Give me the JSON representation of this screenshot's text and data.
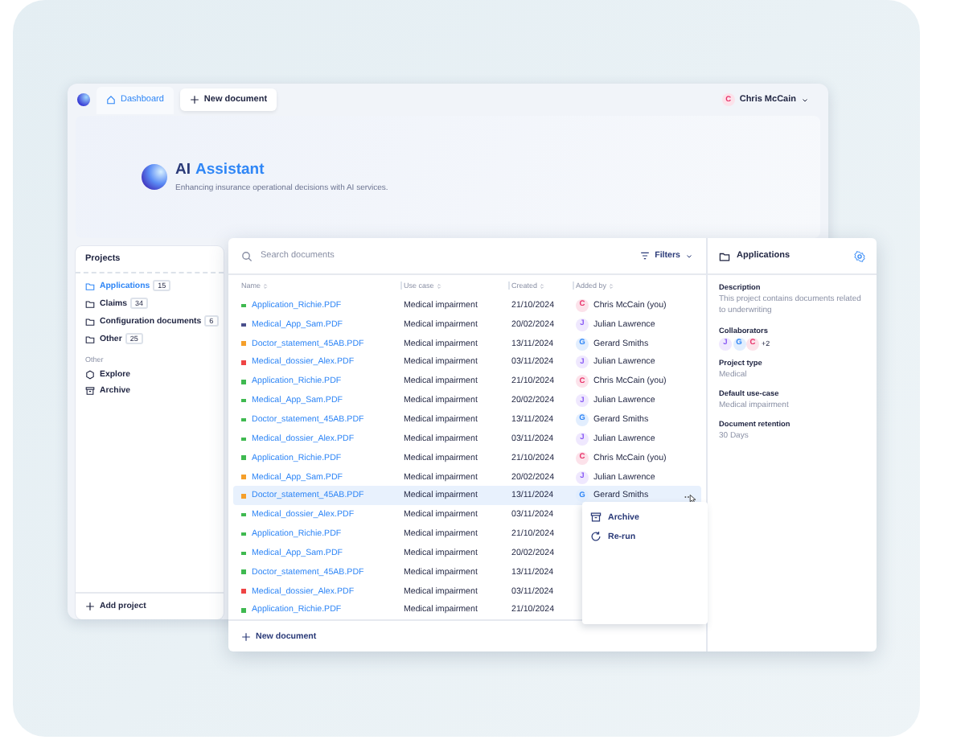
{
  "topbar": {
    "tabs": [
      {
        "label": "Dashboard",
        "selected": true
      },
      {
        "label": "New document",
        "selected": false
      }
    ],
    "user": {
      "initial": "C",
      "name": "Chris McCain",
      "color": "#e8336b"
    }
  },
  "hero": {
    "title": "AI",
    "title_accent": "Assistant",
    "subtitle": "Enhancing insurance operational decisions with AI services."
  },
  "sidebar": {
    "heading": "Projects",
    "projects": [
      {
        "label": "Applications",
        "count": "15",
        "selected": true
      },
      {
        "label": "Claims",
        "count": "34",
        "selected": false
      },
      {
        "label": "Configuration documents",
        "count": "6",
        "selected": false
      },
      {
        "label": "Other",
        "count": "25",
        "selected": false
      }
    ],
    "section": "Other",
    "items": [
      {
        "label": "Explore",
        "kind": "explore"
      },
      {
        "label": "Archive",
        "kind": "archive"
      }
    ],
    "footer": "Add project"
  },
  "documents": {
    "search": {
      "placeholder": "Search documents"
    },
    "filters": "Filters",
    "columns": [
      "Name",
      "Use case",
      "Created",
      "Added by"
    ],
    "rows": [
      {
        "name": "Application_Richie.PDF",
        "color": "#3fb950",
        "use_case": "Medical impairment",
        "created": "21/10/2024",
        "added_by": {
          "initial": "C",
          "name": "Chris McCain (you)",
          "color": "#e8336b"
        },
        "selected": false
      },
      {
        "name": "Medical_App_Sam.PDF",
        "color": "#4a4f8c",
        "use_case": "Medical impairment",
        "created": "20/02/2024",
        "added_by": {
          "initial": "J",
          "name": "Julian Lawrence",
          "color": "#8a5cf5"
        },
        "selected": false
      },
      {
        "name": "Doctor_statement_45AB.PDF",
        "color": "#f59f2a",
        "use_case": "Medical impairment",
        "created": "13/11/2024",
        "added_by": {
          "initial": "G",
          "name": "Gerard Smiths",
          "color": "#2f86f6"
        },
        "selected": false
      },
      {
        "name": "Medical_dossier_Alex.PDF",
        "color": "#ef4444",
        "use_case": "Medical impairment",
        "created": "03/11/2024",
        "added_by": {
          "initial": "J",
          "name": "Julian Lawrence",
          "color": "#8a5cf5"
        },
        "selected": false
      },
      {
        "name": "Application_Richie.PDF",
        "color": "#3fb950",
        "use_case": "Medical impairment",
        "created": "21/10/2024",
        "added_by": {
          "initial": "C",
          "name": "Chris McCain (you)",
          "color": "#e8336b"
        },
        "selected": false
      },
      {
        "name": "Medical_App_Sam.PDF",
        "color": "#3fb950",
        "use_case": "Medical impairment",
        "created": "20/02/2024",
        "added_by": {
          "initial": "J",
          "name": "Julian Lawrence",
          "color": "#8a5cf5"
        },
        "selected": false
      },
      {
        "name": "Doctor_statement_45AB.PDF",
        "color": "#3fb950",
        "use_case": "Medical impairment",
        "created": "13/11/2024",
        "added_by": {
          "initial": "G",
          "name": "Gerard Smiths",
          "color": "#2f86f6"
        },
        "selected": false
      },
      {
        "name": "Medical_dossier_Alex.PDF",
        "color": "#3fb950",
        "use_case": "Medical impairment",
        "created": "03/11/2024",
        "added_by": {
          "initial": "J",
          "name": "Julian Lawrence",
          "color": "#8a5cf5"
        },
        "selected": false
      },
      {
        "name": "Application_Richie.PDF",
        "color": "#3fb950",
        "use_case": "Medical impairment",
        "created": "21/10/2024",
        "added_by": {
          "initial": "C",
          "name": "Chris McCain (you)",
          "color": "#e8336b"
        },
        "selected": false
      },
      {
        "name": "Medical_App_Sam.PDF",
        "color": "#f59f2a",
        "use_case": "Medical impairment",
        "created": "20/02/2024",
        "added_by": {
          "initial": "J",
          "name": "Julian Lawrence",
          "color": "#8a5cf5"
        },
        "selected": false
      },
      {
        "name": "Doctor_statement_45AB.PDF",
        "color": "#f59f2a",
        "use_case": "Medical impairment",
        "created": "13/11/2024",
        "added_by": {
          "initial": "G",
          "name": "Gerard Smiths",
          "color": "#2f86f6"
        },
        "selected": true
      },
      {
        "name": "Medical_dossier_Alex.PDF",
        "color": "#3fb950",
        "use_case": "Medical impairment",
        "created": "03/11/2024",
        "selected": false
      },
      {
        "name": "Application_Richie.PDF",
        "color": "#3fb950",
        "use_case": "Medical impairment",
        "created": "21/10/2024",
        "selected": false
      },
      {
        "name": "Medical_App_Sam.PDF",
        "color": "#3fb950",
        "use_case": "Medical impairment",
        "created": "20/02/2024",
        "selected": false
      },
      {
        "name": "Doctor_statement_45AB.PDF",
        "color": "#3fb950",
        "use_case": "Medical impairment",
        "created": "13/11/2024",
        "selected": false
      },
      {
        "name": "Medical_dossier_Alex.PDF",
        "color": "#ef4444",
        "use_case": "Medical impairment",
        "created": "03/11/2024",
        "selected": false
      },
      {
        "name": "Application_Richie.PDF",
        "color": "#3fb950",
        "use_case": "Medical impairment",
        "created": "21/10/2024",
        "selected": false
      }
    ],
    "menu": [
      {
        "label": "Archive",
        "kind": "archive"
      },
      {
        "label": "Re-run",
        "kind": "rerun"
      }
    ],
    "footer": "New document"
  },
  "details": {
    "title": "Applications",
    "fields": [
      {
        "label": "Description",
        "kind": "text",
        "value": "This project contains documents related to underwriting"
      },
      {
        "label": "Collaborators",
        "kind": "avatars",
        "avatars": [
          {
            "initial": "J",
            "color": "#8a5cf5"
          },
          {
            "initial": "G",
            "color": "#2f86f6"
          },
          {
            "initial": "C",
            "color": "#e8336b"
          }
        ],
        "more": "+2"
      },
      {
        "label": "Project type",
        "kind": "text",
        "value": "Medical"
      },
      {
        "label": "Default use-case",
        "kind": "text",
        "value": "Medical impairment"
      },
      {
        "label": "Document retention",
        "kind": "text",
        "value": "30 Days"
      }
    ]
  }
}
